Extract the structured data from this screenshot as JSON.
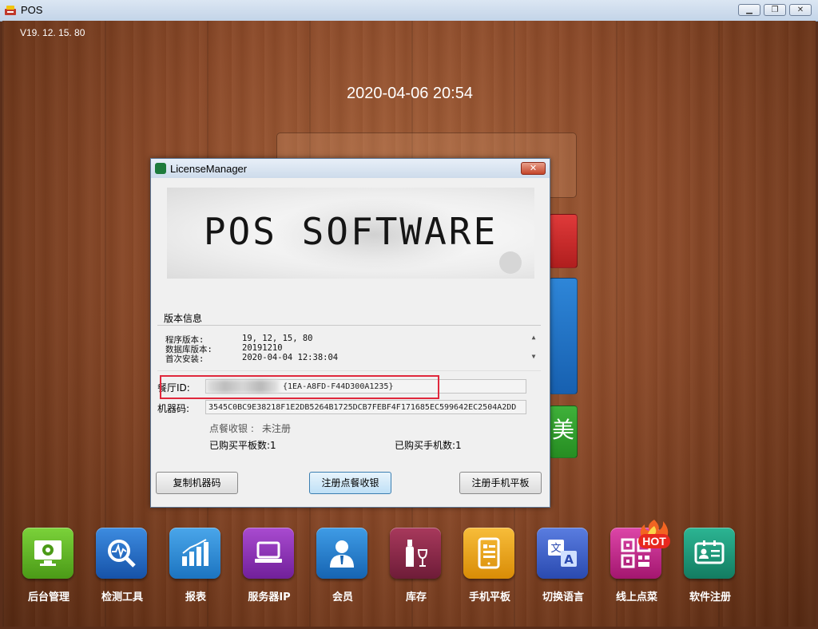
{
  "window": {
    "title": "POS",
    "icon": "pos-app-icon",
    "controls": [
      "minimize-icon",
      "restore-icon",
      "close-icon"
    ]
  },
  "header": {
    "version": "V19. 12. 15. 80",
    "datetime": "2020-04-06 20:54"
  },
  "side_tiles": {
    "green_tile_glyph": "美"
  },
  "colors": {
    "tile_red": "#c92a2a",
    "tile_blue": "#1f73c4",
    "tile_green": "#2f9e2a",
    "highlight_red": "#e0283c"
  },
  "dialog": {
    "title": "LicenseManager",
    "banner_text": "POS SOFTWARE",
    "version_section": {
      "legend": "版本信息",
      "rows": [
        {
          "key": "程序版本:",
          "value": "19, 12, 15, 80"
        },
        {
          "key": "数据库版本:",
          "value": "20191210"
        },
        {
          "key": "首次安装:",
          "value": "2020-04-04 12:38:04"
        }
      ]
    },
    "restaurant_id": {
      "label": "餐厅ID:",
      "value": "{1EA-A8FD-F44D300A1235}"
    },
    "machine_code": {
      "label": "机器码:",
      "value": "3545C0BC9E38218F1E2DB5264B1725DCB7FEBF4F171685EC599642EC2504A2DD"
    },
    "status": {
      "label": "点餐收银 :",
      "value": "未注册"
    },
    "purchased_tablets": "已购买平板数:1",
    "purchased_phones": "已购买手机数:1",
    "buttons": {
      "copy": "复制机器码",
      "register_pos": "注册点餐收银",
      "register_mobile": "注册手机平板"
    }
  },
  "bottom_apps": [
    {
      "label": "后台管理",
      "icon": "monitor-gear-icon",
      "color": "#5fb324"
    },
    {
      "label": "检测工具",
      "icon": "magnifier-pulse-icon",
      "color": "#1f6fc9"
    },
    {
      "label": "报表",
      "icon": "bar-chart-icon",
      "color": "#2a8fd9"
    },
    {
      "label": "服务器IP",
      "icon": "laptop-icon",
      "color": "#8c2fb4"
    },
    {
      "label": "会员",
      "icon": "user-icon",
      "color": "#1f82cc"
    },
    {
      "label": "库存",
      "icon": "wine-bottle-icon",
      "color": "#8e2a4a"
    },
    {
      "label": "手机平板",
      "icon": "tablet-icon",
      "color": "#f0a514"
    },
    {
      "label": "切换语言",
      "icon": "translate-icon",
      "color": "#3b5fc9"
    },
    {
      "label": "线上点菜",
      "icon": "qr-code-icon",
      "color": "#c5268e",
      "badge": "HOT"
    },
    {
      "label": "软件注册",
      "icon": "id-card-icon",
      "color": "#1f9a7c"
    }
  ]
}
